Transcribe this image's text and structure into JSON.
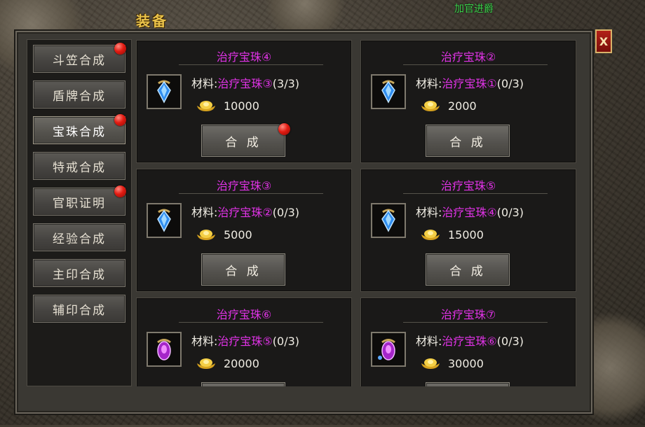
{
  "window": {
    "title": "装备",
    "close_label": "X"
  },
  "overlay_text": "加官进爵",
  "sidebar": {
    "items": [
      {
        "label": "斗笠合成",
        "badge": true
      },
      {
        "label": "盾牌合成",
        "badge": false
      },
      {
        "label": "宝珠合成",
        "badge": true,
        "active": true
      },
      {
        "label": "特戒合成",
        "badge": false
      },
      {
        "label": "官职证明",
        "badge": true
      },
      {
        "label": "经验合成",
        "badge": false
      },
      {
        "label": "主印合成",
        "badge": false
      },
      {
        "label": "辅印合成",
        "badge": false
      }
    ]
  },
  "material_prefix": "材料:",
  "merge_label": "合 成",
  "cards": [
    {
      "title": "治疗宝珠④",
      "material": "治疗宝珠③",
      "count": "(3/3)",
      "cost": "10000",
      "gem": "blue-gem",
      "badge": true
    },
    {
      "title": "治疗宝珠②",
      "material": "治疗宝珠①",
      "count": "(0/3)",
      "cost": "2000",
      "gem": "blue-gem",
      "badge": false
    },
    {
      "title": "治疗宝珠③",
      "material": "治疗宝珠②",
      "count": "(0/3)",
      "cost": "5000",
      "gem": "blue-gem",
      "badge": false
    },
    {
      "title": "治疗宝珠⑤",
      "material": "治疗宝珠④",
      "count": "(0/3)",
      "cost": "15000",
      "gem": "blue-gem",
      "badge": false
    },
    {
      "title": "治疗宝珠⑥",
      "material": "治疗宝珠⑤",
      "count": "(0/3)",
      "cost": "20000",
      "gem": "purple-gem",
      "badge": false
    },
    {
      "title": "治疗宝珠⑦",
      "material": "治疗宝珠⑥",
      "count": "(0/3)",
      "cost": "30000",
      "gem": "purple-gem",
      "badge": false
    }
  ],
  "colors": {
    "item_name": "#e233e8",
    "title_gold": "#e9c24a",
    "badge_red": "#e21b12",
    "overlay_green": "#3ad04a"
  }
}
